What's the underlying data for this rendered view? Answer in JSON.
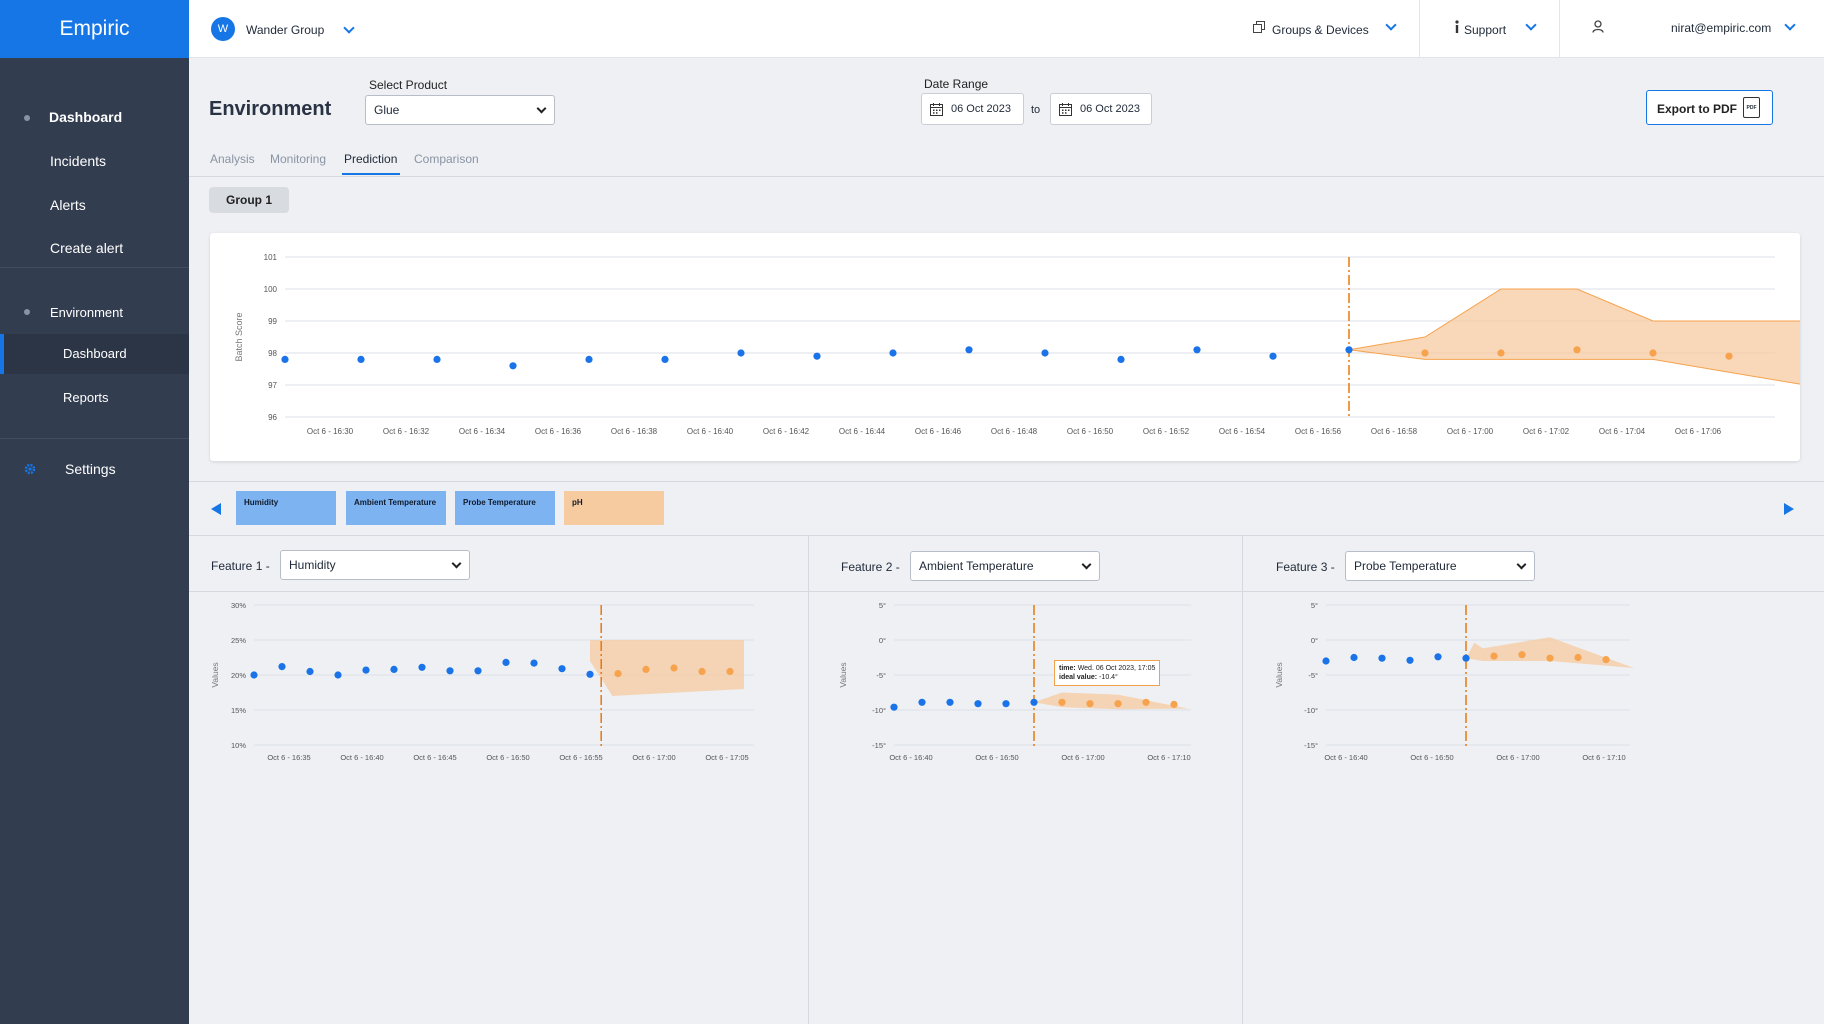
{
  "app": {
    "logo": "Empiric"
  },
  "sidebar": {
    "items": [
      {
        "label": "Dashboard"
      },
      {
        "label": "Incidents"
      },
      {
        "label": "Alerts"
      },
      {
        "label": "Create alert"
      },
      {
        "label": "Environment"
      },
      {
        "label": "Dashboard"
      },
      {
        "label": "Reports"
      },
      {
        "label": "Settings"
      }
    ]
  },
  "topbar": {
    "org_initial": "W",
    "org_name": "Wander Group",
    "groups_label": "Groups & Devices",
    "support_label": "Support",
    "user_email": "nirat@empiric.com"
  },
  "page": {
    "title": "Environment",
    "product_label": "Select Product",
    "product_value": "Glue",
    "date_range_label": "Date Range",
    "date_from": "06 Oct 2023",
    "date_to_word": "to",
    "date_to": "06 Oct 2023",
    "export_label": "Export to PDF",
    "export_icon_text": "PDF"
  },
  "tabs": [
    {
      "label": "Analysis"
    },
    {
      "label": "Monitoring"
    },
    {
      "label": "Prediction",
      "active": true
    },
    {
      "label": "Comparison"
    }
  ],
  "group_chip": "Group 1",
  "feature_chips": [
    {
      "label": "Humidity",
      "color": "#7db3f0"
    },
    {
      "label": "Ambient Temperature",
      "color": "#7db3f0"
    },
    {
      "label": "Probe Temperature",
      "color": "#7db3f0"
    },
    {
      "label": "pH",
      "color": "#f6cba0"
    }
  ],
  "features": [
    {
      "prefix": "Feature 1",
      "dash": "-",
      "value": "Humidity"
    },
    {
      "prefix": "Feature 2",
      "dash": "-",
      "value": "Ambient Temperature"
    },
    {
      "prefix": "Feature 3",
      "dash": "-",
      "value": "Probe Temperature"
    }
  ],
  "tooltip": {
    "time_label": "time:",
    "time_value": "Wed. 06 Oct 2023, 17:05",
    "ideal_label": "ideal value:",
    "ideal_value": "-10.4°"
  },
  "colors": {
    "accent": "#1676e6",
    "actual": "#1a73e8",
    "predicted": "#f7a24d",
    "band": "#f6cba0",
    "divider": "#e8780c"
  },
  "chart_data": [
    {
      "type": "scatter",
      "ylabel": "Batch Score",
      "ylim": [
        96,
        101
      ],
      "yticks": [
        "96",
        "97",
        "98",
        "99",
        "100",
        "101"
      ],
      "xticks": [
        "Oct 6 - 16:30",
        "Oct 6 - 16:32",
        "Oct 6 - 16:34",
        "Oct 6 - 16:36",
        "Oct 6 - 16:38",
        "Oct 6 - 16:40",
        "Oct 6 - 16:42",
        "Oct 6 - 16:44",
        "Oct 6 - 16:46",
        "Oct 6 - 16:48",
        "Oct 6 - 16:50",
        "Oct 6 - 16:52",
        "Oct 6 - 16:54",
        "Oct 6 - 16:56",
        "Oct 6 - 16:58",
        "Oct 6 - 17:00",
        "Oct 6 - 17:02",
        "Oct 6 - 17:04",
        "Oct 6 - 17:06"
      ],
      "x_minutes_from": "Oct 6 - 16:30",
      "x_step_minutes": 2,
      "series": [
        {
          "role": "actual",
          "x": [
            0,
            1,
            2,
            3,
            4,
            5,
            6,
            7,
            8,
            9,
            10,
            11,
            12,
            13,
            14
          ],
          "values": [
            97.8,
            97.8,
            97.8,
            97.6,
            97.8,
            97.8,
            98.0,
            97.9,
            98.0,
            98.1,
            98.0,
            97.8,
            98.1,
            97.9,
            98.1
          ]
        },
        {
          "role": "predicted",
          "x": [
            15,
            16,
            17,
            18,
            19
          ],
          "values": [
            98.0,
            98.0,
            98.1,
            98.0,
            97.9
          ]
        }
      ],
      "band": {
        "x": [
          14,
          15,
          16,
          17,
          18,
          19,
          20
        ],
        "upper": [
          98.1,
          98.5,
          100.0,
          100.0,
          99.0,
          99.0,
          99.0
        ],
        "lower": [
          98.1,
          97.8,
          97.8,
          97.8,
          97.8,
          97.4,
          97.0
        ]
      },
      "divider_x": 14
    },
    {
      "type": "scatter",
      "ylabel": "Values",
      "ylim": [
        10,
        30
      ],
      "yticks": [
        "10%",
        "15%",
        "20%",
        "25%",
        "30%"
      ],
      "xticks": [
        "Oct 6 - 16:35",
        "Oct 6 - 16:40",
        "Oct 6 - 16:45",
        "Oct 6 - 16:50",
        "Oct 6 - 16:55",
        "Oct 6 - 17:00",
        "Oct 6 - 17:05"
      ],
      "series": [
        {
          "role": "actual",
          "x": [
            0,
            1,
            2,
            3,
            4,
            5,
            6,
            7,
            8,
            9,
            10,
            11,
            12
          ],
          "values": [
            20.0,
            21.2,
            20.5,
            20.0,
            20.7,
            20.8,
            21.1,
            20.6,
            20.6,
            21.8,
            21.7,
            20.9,
            20.1
          ]
        },
        {
          "role": "predicted",
          "x": [
            13,
            14,
            15,
            16,
            17
          ],
          "values": [
            20.2,
            20.8,
            21.0,
            20.5,
            20.5
          ]
        }
      ],
      "band": {
        "x": [
          12,
          12.8,
          17.5
        ],
        "upper": [
          25.0,
          25.0,
          25.0
        ],
        "lower": [
          22.0,
          17.0,
          18.0
        ]
      },
      "divider_x": 12.4,
      "x_index_span": 17.5
    },
    {
      "type": "scatter",
      "ylabel": "Values",
      "ylim": [
        -15,
        5
      ],
      "yticks": [
        "-15°",
        "-10°",
        "-5°",
        "0°",
        "5°"
      ],
      "xticks": [
        "Oct 6 - 16:40",
        "Oct 6 - 16:50",
        "Oct 6 - 17:00",
        "Oct 6 - 17:10"
      ],
      "series": [
        {
          "role": "actual",
          "x": [
            0,
            1,
            2,
            3,
            4,
            5
          ],
          "values": [
            -9.6,
            -8.9,
            -8.9,
            -9.1,
            -9.1,
            -8.9
          ]
        },
        {
          "role": "predicted",
          "x": [
            6,
            7,
            8,
            9,
            10
          ],
          "values": [
            -8.9,
            -9.1,
            -9.1,
            -8.9,
            -9.2
          ]
        }
      ],
      "band": {
        "x": [
          5,
          6,
          8,
          10.5
        ],
        "upper": [
          -8.9,
          -7.5,
          -7.8,
          -9.8
        ],
        "lower": [
          -8.9,
          -9.6,
          -9.9,
          -9.8
        ]
      },
      "divider_x": 5,
      "x_index_span": 10.5
    },
    {
      "type": "scatter",
      "ylabel": "Values",
      "ylim": [
        -15,
        5
      ],
      "yticks": [
        "-15°",
        "-10°",
        "-5°",
        "0°",
        "5°"
      ],
      "xticks": [
        "Oct 6 - 16:40",
        "Oct 6 - 16:50",
        "Oct 6 - 17:00",
        "Oct 6 - 17:10"
      ],
      "series": [
        {
          "role": "actual",
          "x": [
            0,
            1,
            2,
            3,
            4,
            5
          ],
          "values": [
            -3.0,
            -2.5,
            -2.6,
            -2.9,
            -2.4,
            -2.6
          ]
        },
        {
          "role": "predicted",
          "x": [
            6,
            7,
            8,
            9,
            10
          ],
          "values": [
            -2.3,
            -2.1,
            -2.6,
            -2.5,
            -2.8
          ]
        }
      ],
      "band": {
        "x": [
          5,
          5.3,
          5.6,
          8,
          11
        ],
        "upper": [
          -2.6,
          -0.4,
          -1.2,
          0.4,
          -4.0
        ],
        "lower": [
          -2.6,
          -2.8,
          -3.0,
          -3.0,
          -4.0
        ]
      },
      "divider_x": 5,
      "x_index_span": 11
    }
  ]
}
